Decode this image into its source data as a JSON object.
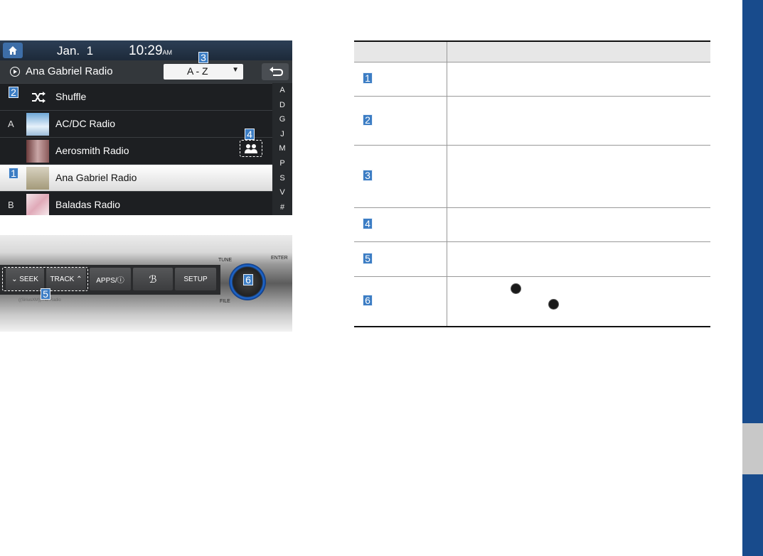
{
  "screen": {
    "date": "Jan.  1",
    "time": "10:29",
    "ampm": "AM",
    "now_playing": "Ana Gabriel Radio",
    "sort": "A - Z",
    "list": [
      {
        "marker": "2",
        "letter": "",
        "name": "Shuffle",
        "type": "shuffle"
      },
      {
        "marker": "",
        "letter": "A",
        "name": "AC/DC Radio",
        "type": "station"
      },
      {
        "marker": "",
        "letter": "",
        "name": "Aerosmith Radio",
        "type": "station"
      },
      {
        "marker": "1",
        "letter": "",
        "name": "Ana Gabriel Radio",
        "type": "station",
        "selected": true
      },
      {
        "marker": "",
        "letter": "B",
        "name": "Baladas Radio",
        "type": "station"
      }
    ],
    "alpha_index": [
      "A",
      "D",
      "G",
      "J",
      "M",
      "P",
      "S",
      "V",
      "#"
    ],
    "markers": {
      "sort": "3",
      "artist": "4"
    }
  },
  "panel": {
    "seek": "SEEK",
    "track": "TRACK",
    "apps": "APPS/ⓘ",
    "setup": "SETUP",
    "tune": "TUNE",
    "enter": "ENTER",
    "file": "FILE",
    "brand_text": "((SiriusXM)) HD Radio",
    "markers": {
      "seek_track": "5",
      "knob": "6"
    }
  },
  "table": {
    "rows": [
      "1",
      "2",
      "3",
      "4",
      "5",
      "6"
    ]
  },
  "colors": {
    "brand_blue": "#184b8c",
    "marker_blue": "#3c7dc4",
    "edge_gray": "#c8c8c8"
  }
}
